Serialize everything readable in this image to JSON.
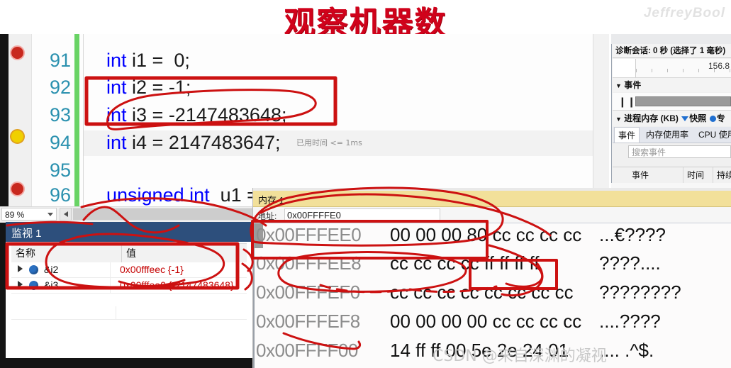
{
  "banner": {
    "title": "观察机器数",
    "watermark": "JeffreyBool"
  },
  "editor": {
    "zoom_level": "89 %",
    "codelens": "已用时间 <= 1ms",
    "lines": [
      {
        "number": "91",
        "code": "int i1 =  0;"
      },
      {
        "number": "92",
        "code": "int i2 = -1;"
      },
      {
        "number": "93",
        "code": "int i3 = -2147483648;"
      },
      {
        "number": "94",
        "code": "int i4 = 2147483647;"
      },
      {
        "number": "95",
        "code": ""
      },
      {
        "number": "96",
        "code": "unsigned int  u1 ="
      }
    ]
  },
  "diagnostics": {
    "session_label": "诊断会话: 0 秒 (选择了 1 毫秒)",
    "graph_value": "156.8",
    "events_header": "事件",
    "process_memory_header": "进程内存 (KB)",
    "snapshot_label": "快照",
    "private_label": "专",
    "tabs": [
      {
        "label": "事件",
        "selected": true
      },
      {
        "label": "内存使用率",
        "selected": false
      },
      {
        "label": "CPU 使用率",
        "selected": false
      }
    ],
    "search_placeholder": "搜索事件",
    "columns": [
      "事件",
      "时间",
      "持续"
    ]
  },
  "watch": {
    "title": "监视 1",
    "columns": [
      "名称",
      "值"
    ],
    "rows": [
      {
        "name": "&i2",
        "value": "0x00fffeec {-1}"
      },
      {
        "name": "&i3",
        "value": "0x00fffee0 {-2147483648}"
      }
    ]
  },
  "memory": {
    "title": "内存 1",
    "address_label": "地址:",
    "address_value": "0x00FFFFE0",
    "rows": [
      {
        "address": "0x00FFFEE0",
        "bytes": "00 00 00 80 cc cc cc cc",
        "ascii": "...€????"
      },
      {
        "address": "0x00FFFEE8",
        "bytes": "cc cc cc cc ff ff ff ff",
        "ascii": "????...."
      },
      {
        "address": "0x00FFFEF0",
        "bytes": "cc cc cc cc cc cc cc cc",
        "ascii": "????????"
      },
      {
        "address": "0x00FFFEF8",
        "bytes": "00 00 00 00 cc cc cc cc",
        "ascii": "....????"
      },
      {
        "address": "0x00FFFF00",
        "bytes": "14 ff ff 00 5e 2e 24 01",
        "ascii": ".... .^$."
      }
    ]
  },
  "watermark_csdn": "CSDN @来自深渊的凝视",
  "colors": {
    "title_red": "#d0021b",
    "annotation_red": "#cc1111",
    "keyword_blue": "#0000ff",
    "line_number_blue": "#2b91af",
    "watch_value_red": "#c40000",
    "watch_title_bg": "#2d4f7c",
    "memory_title_bg": "#f2e09a",
    "change_bar_green": "#69d365"
  }
}
